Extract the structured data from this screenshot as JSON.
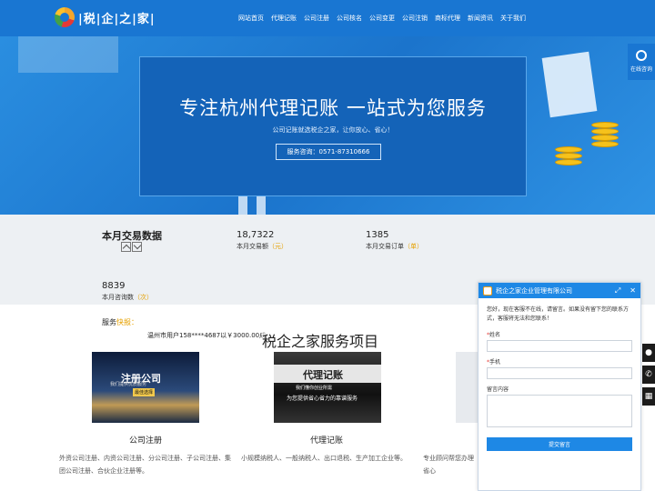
{
  "header": {
    "logo_text": "|税|企|之|家|",
    "nav": [
      "网站首页",
      "代理记账",
      "公司注册",
      "公司核名",
      "公司变更",
      "公司注销",
      "商标代理",
      "新闻资讯",
      "关于我们"
    ]
  },
  "hero": {
    "title": "专注杭州代理记账 一站式为您服务",
    "subtitle": "公司记账就选税企之家，让你放心、省心！",
    "button": "服务咨询：0571-87310666"
  },
  "consult": {
    "label": "在线咨询",
    "icon": "headset-icon"
  },
  "stats": {
    "title": "本月交易数据",
    "items": [
      {
        "value": "18,7322",
        "label": "本月交易额",
        "unit": "（元）"
      },
      {
        "value": "1385",
        "label": "本月交易订单",
        "unit": "（单）"
      },
      {
        "value": "8839",
        "label": "本月咨询数",
        "unit": "（次）"
      }
    ]
  },
  "ticker": {
    "label": "服务",
    "label_hl": "快报：",
    "text": "温州市用户158****4687以￥3000.00成"
  },
  "services": {
    "title": "税企之家服务项目",
    "items": [
      {
        "banner": "注册公司",
        "banner_sub": "我们提供优质服务",
        "banner_tag": "最佳选择",
        "name": "公司注册",
        "desc": "外资公司注册、内资公司注册、分公司注册、子公司注册、集团公司注册、合伙企业注册等。"
      },
      {
        "banner": "代理记账",
        "banner_sub": "我们懂你创业所需",
        "banner_tag": "为您提供省心省力的靠谱服务",
        "name": "代理记账",
        "desc": "小规模纳税人、一般纳税人、出口退税、生产加工企业等。"
      },
      {
        "desc": "专业顾问帮您办理省心"
      }
    ]
  },
  "chat": {
    "company": "税企之家企业管理有限公司",
    "message": "您好，现在客服不在线，请留言。如果没有留下您的联系方式，客服将无法和您联系！",
    "fields": {
      "name": "姓名",
      "phone": "手机",
      "content": "留言内容"
    },
    "submit": "提交留言"
  }
}
